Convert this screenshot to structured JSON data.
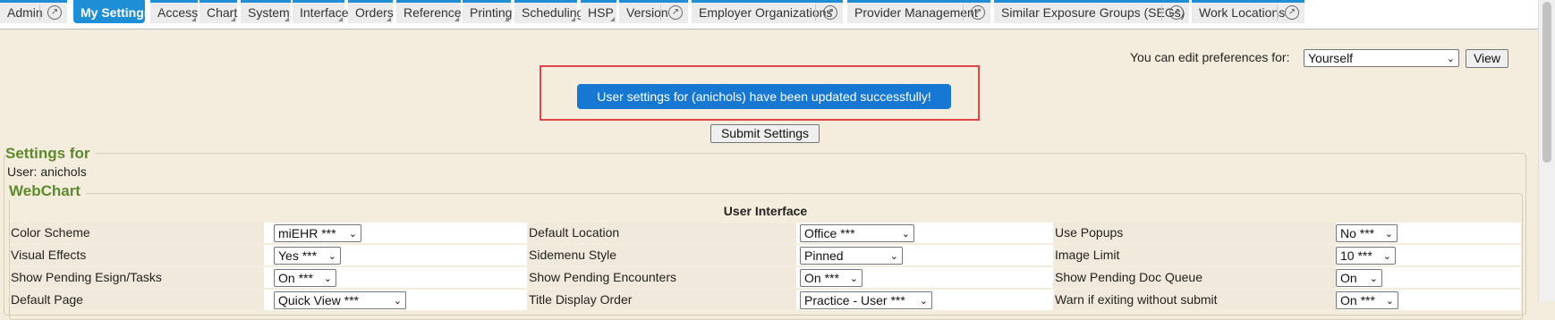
{
  "nav": {
    "tabs": [
      {
        "label": "Admin",
        "active": false,
        "external": true
      },
      {
        "label": "My Settings",
        "active": true,
        "external": false
      },
      {
        "label": "Access",
        "active": false,
        "external": false
      },
      {
        "label": "Chart",
        "active": false,
        "external": false
      },
      {
        "label": "System",
        "active": false,
        "external": false
      },
      {
        "label": "Interface",
        "active": false,
        "external": false
      },
      {
        "label": "Orders",
        "active": false,
        "external": false
      },
      {
        "label": "Reference",
        "active": false,
        "external": false
      },
      {
        "label": "Printing",
        "active": false,
        "external": false
      },
      {
        "label": "Scheduling",
        "active": false,
        "external": false
      },
      {
        "label": "HSP",
        "active": false,
        "external": false
      },
      {
        "label": "Version",
        "active": false,
        "external": true
      },
      {
        "label": "Employer Organizations",
        "active": false,
        "external": true
      },
      {
        "label": "Provider Management",
        "active": false,
        "external": true
      },
      {
        "label": "Similar Exposure Groups (SEGs)",
        "active": false,
        "external": true
      },
      {
        "label": "Work Locations",
        "active": false,
        "external": true
      }
    ]
  },
  "preferences": {
    "label": "You can edit preferences for:",
    "selected": "Yourself",
    "view_button": "View"
  },
  "message": {
    "success": "User settings for (anichols) have been updated successfully!"
  },
  "submit_button": "Submit Settings",
  "settings": {
    "legend": "Settings for",
    "user_line": "User: anichols",
    "webchart_legend": "WebChart",
    "section_title": "User Interface",
    "rows": [
      [
        {
          "label": "Color Scheme",
          "value": "miEHR ***"
        },
        {
          "label": "Default Location",
          "value": "Office ***"
        },
        {
          "label": "Use Popups",
          "value": "No ***"
        }
      ],
      [
        {
          "label": "Visual Effects",
          "value": "Yes ***"
        },
        {
          "label": "Sidemenu Style",
          "value": "Pinned"
        },
        {
          "label": "Image Limit",
          "value": "10 ***"
        }
      ],
      [
        {
          "label": "Show Pending Esign/Tasks",
          "value": "On ***"
        },
        {
          "label": "Show Pending Encounters",
          "value": "On ***"
        },
        {
          "label": "Show Pending Doc Queue",
          "value": "On"
        }
      ],
      [
        {
          "label": "Default Page",
          "value": "Quick View ***"
        },
        {
          "label": "Title Display Order",
          "value": "Practice - User ***"
        },
        {
          "label": "Warn if exiting without submit",
          "value": "On ***"
        }
      ]
    ]
  }
}
